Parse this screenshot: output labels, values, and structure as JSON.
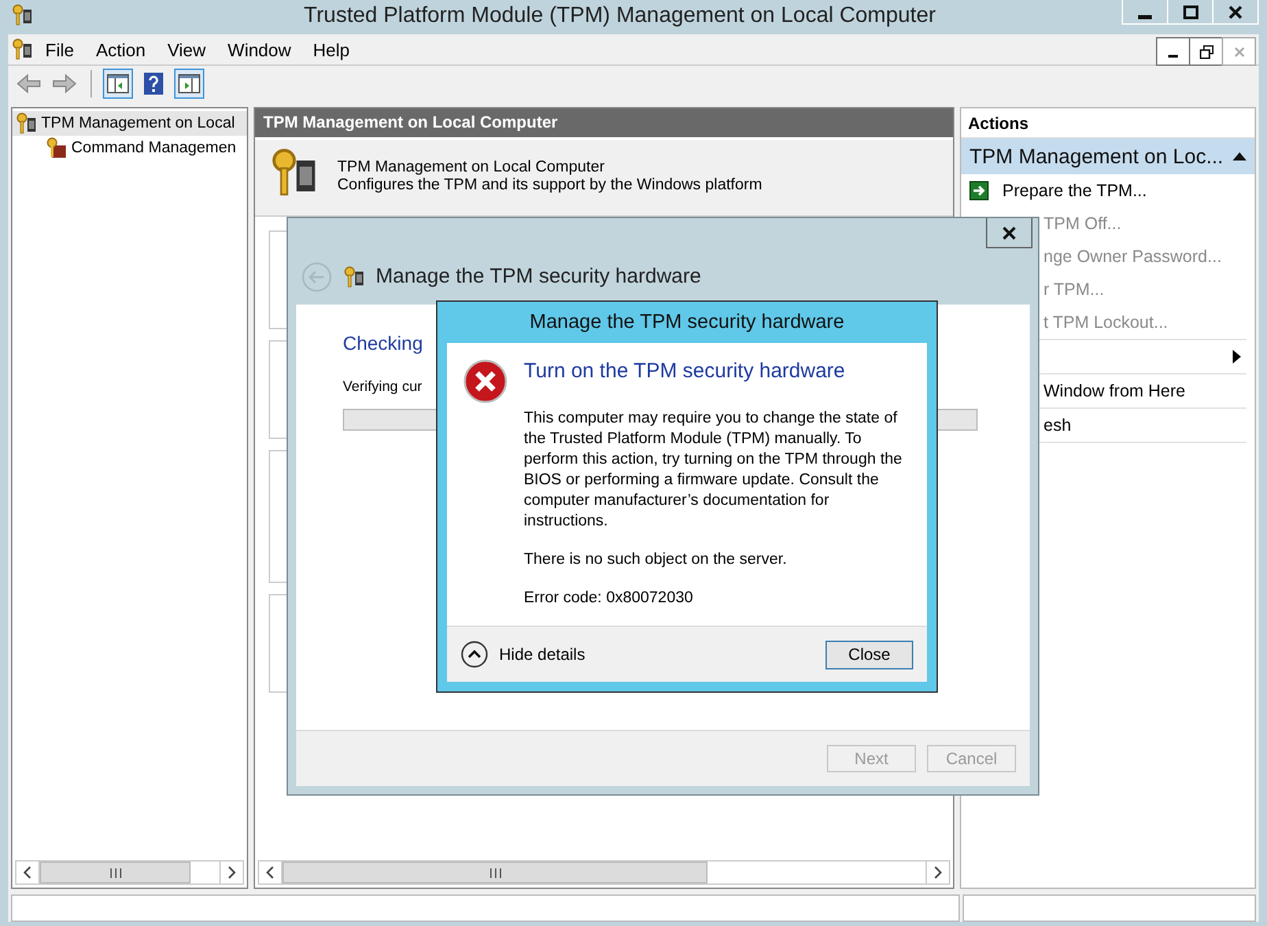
{
  "window": {
    "title": "Trusted Platform Module (TPM) Management on Local Computer"
  },
  "menu": [
    "File",
    "Action",
    "View",
    "Window",
    "Help"
  ],
  "tree": {
    "items": [
      {
        "label": "TPM Management on Local",
        "selected": true,
        "children": [
          {
            "label": "Command Managemen",
            "selected": false
          }
        ]
      }
    ]
  },
  "center": {
    "header": "TPM Management on Local Computer",
    "description": {
      "title": "TPM Management on Local Computer",
      "text": "Configures the TPM and its support by the Windows platform"
    }
  },
  "actions": {
    "title": "Actions",
    "section": {
      "label": "TPM Management on Loc...",
      "expanded": true
    },
    "groups": [
      [
        {
          "kind": "action",
          "label": "Prepare the TPM...",
          "disabled": false
        },
        {
          "kind": "covered",
          "label": "TPM Off...",
          "disabled": true
        },
        {
          "kind": "covered",
          "label": "nge Owner Password...",
          "disabled": true
        },
        {
          "kind": "covered",
          "label": "r TPM...",
          "disabled": true
        },
        {
          "kind": "covered",
          "label": "t TPM Lockout...",
          "disabled": true
        }
      ],
      [
        {
          "kind": "submenu",
          "disabled": false
        }
      ],
      [
        {
          "kind": "covered",
          "label": "Window from Here",
          "disabled": false
        }
      ],
      [
        {
          "kind": "covered",
          "label": "esh",
          "disabled": false
        }
      ]
    ]
  },
  "wizard": {
    "title": "Manage the TPM security hardware",
    "heading": "Checking",
    "status": "Verifying cur",
    "progress": {
      "level": 0
    },
    "buttons": [
      {
        "label": "Next",
        "disabled": true
      },
      {
        "label": "Cancel",
        "disabled": true
      }
    ]
  },
  "error": {
    "title": "Manage the TPM security hardware",
    "heading": "Turn on the TPM security hardware",
    "paragraphs": [
      "This computer may require you to change the state of the Trusted Platform Module (TPM) manually.  To perform this action, try turning on the TPM through the BIOS or performing a firmware update.  Consult the computer manufacturer’s documentation for instructions.",
      "There is no such object on the server.",
      "Error code: 0x80072030"
    ],
    "details_toggle": {
      "label": "Hide details",
      "expanded": true
    },
    "button": "Close"
  }
}
